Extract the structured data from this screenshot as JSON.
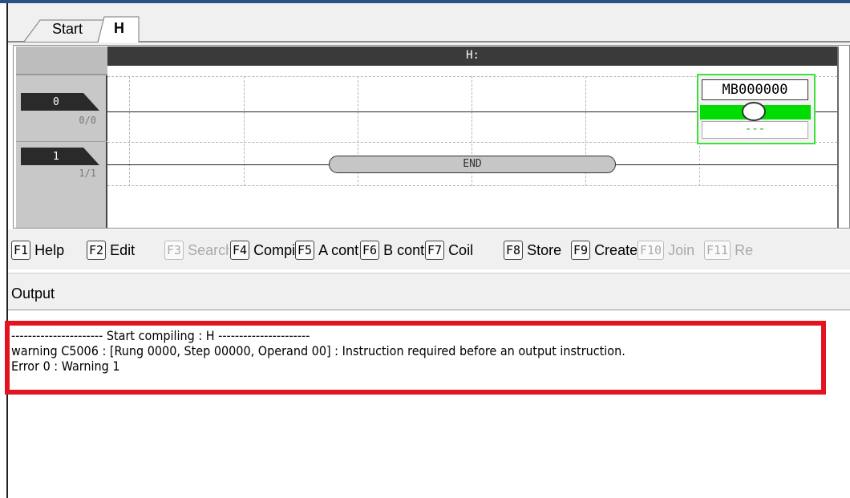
{
  "tabs": [
    {
      "label": "Start",
      "active": false
    },
    {
      "label": "H",
      "active": true
    }
  ],
  "ladder": {
    "header": "H:",
    "rungs": [
      {
        "number": "0",
        "steps": "0/0"
      },
      {
        "number": "1",
        "steps": "1/1"
      }
    ],
    "coil": {
      "address": "MB000000",
      "comment": "---"
    },
    "end_label": "END"
  },
  "fkeys": [
    {
      "key": "F1",
      "label": "Help",
      "enabled": true
    },
    {
      "key": "F2",
      "label": "Edit",
      "enabled": true
    },
    {
      "key": "F3",
      "label": "Search",
      "enabled": false
    },
    {
      "key": "F4",
      "label": "Compile",
      "enabled": true
    },
    {
      "key": "F5",
      "label": "A contact",
      "enabled": true
    },
    {
      "key": "F6",
      "label": "B contact",
      "enabled": true
    },
    {
      "key": "F7",
      "label": "Coil",
      "enabled": true
    },
    {
      "key": "F8",
      "label": "Store",
      "enabled": true
    },
    {
      "key": "F9",
      "label": "Create",
      "enabled": true
    },
    {
      "key": "F10",
      "label": "Join",
      "enabled": false
    },
    {
      "key": "F11",
      "label": "Re",
      "enabled": false
    }
  ],
  "output": {
    "title": "Output",
    "lines": [
      "---------------------- Start compiling : H ----------------------",
      "warning C5006 : [Rung 0000, Step 00000, Operand 00] : Instruction required before an output instruction.",
      "Error 0 : Warning 1"
    ]
  },
  "colors": {
    "highlight": "#e3141f",
    "coil_green": "#00dd00",
    "title_bar": "#2b4f8a"
  }
}
